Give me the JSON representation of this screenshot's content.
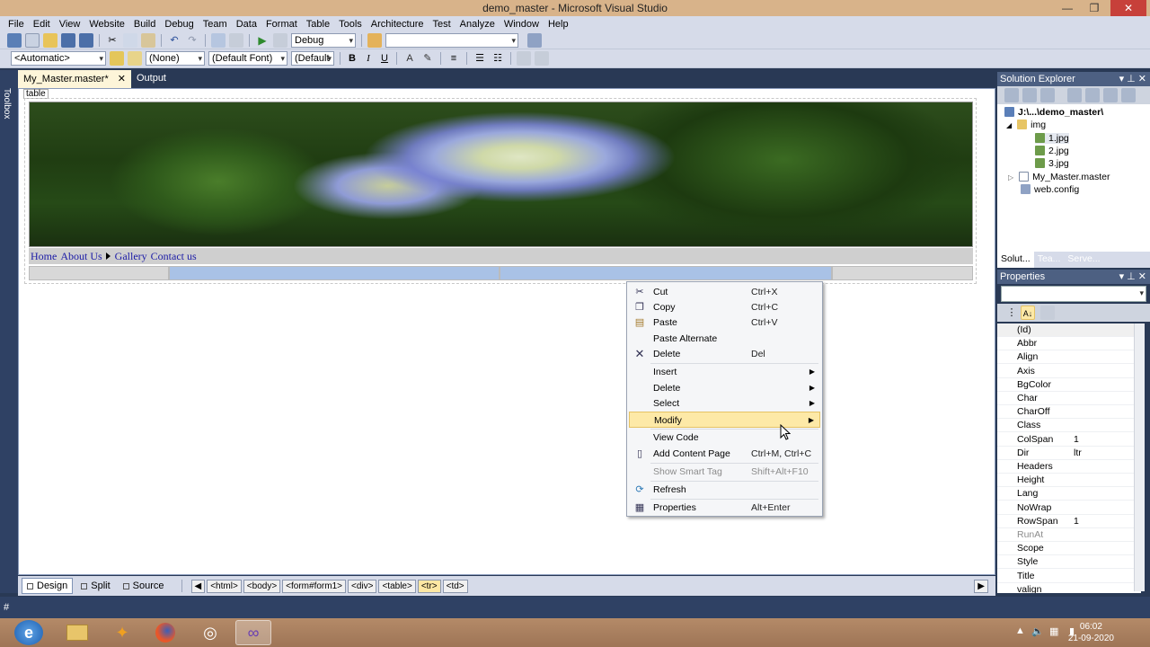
{
  "window": {
    "title": "demo_master - Microsoft Visual Studio",
    "controls": {
      "minimize": "—",
      "maximize": "❐",
      "close": "✕"
    }
  },
  "menu": [
    "File",
    "Edit",
    "View",
    "Website",
    "Build",
    "Debug",
    "Team",
    "Data",
    "Format",
    "Table",
    "Tools",
    "Architecture",
    "Test",
    "Analyze",
    "Window",
    "Help"
  ],
  "toolbar1": {
    "config": "Debug",
    "find": ""
  },
  "toolbar2": {
    "target": "<Automatic>",
    "style": "(None)",
    "font": "(Default Font)",
    "size": "(Default",
    "bold": "B",
    "italic": "I",
    "underline": "U"
  },
  "toolbox": {
    "label": "Toolbox"
  },
  "doc_tabs": [
    {
      "label": "My_Master.master*",
      "close": "✕"
    },
    {
      "label": "Output"
    }
  ],
  "design": {
    "tag_label": "table",
    "nav": [
      "Home",
      "About Us",
      "Gallery",
      "Contact us"
    ]
  },
  "context_menu": {
    "items": [
      {
        "label": "Cut",
        "shortcut": "Ctrl+X",
        "icon": "scissors-icon"
      },
      {
        "label": "Copy",
        "shortcut": "Ctrl+C",
        "icon": "copy-icon"
      },
      {
        "label": "Paste",
        "shortcut": "Ctrl+V",
        "icon": "paste-icon"
      },
      {
        "label": "Paste Alternate",
        "shortcut": ""
      },
      {
        "label": "Delete",
        "shortcut": "Del",
        "icon": "delete-x-icon"
      },
      {
        "label": "Insert",
        "shortcut": "",
        "submenu": true
      },
      {
        "label": "Delete",
        "shortcut": "",
        "submenu": true
      },
      {
        "label": "Select",
        "shortcut": "",
        "submenu": true
      },
      {
        "label": "Modify",
        "shortcut": "",
        "submenu": true,
        "highlighted": true
      },
      {
        "label": "View Code",
        "shortcut": ""
      },
      {
        "label": "Add Content Page",
        "shortcut": "Ctrl+M, Ctrl+C",
        "icon": "page-icon"
      },
      {
        "label": "Show Smart Tag",
        "shortcut": "Shift+Alt+F10",
        "disabled": true
      },
      {
        "label": "Refresh",
        "shortcut": "",
        "icon": "refresh-icon"
      },
      {
        "label": "Properties",
        "shortcut": "Alt+Enter",
        "icon": "properties-icon"
      }
    ]
  },
  "view_bar": {
    "design": "Design",
    "split": "Split",
    "source": "Source",
    "crumbs": [
      "<html>",
      "<body>",
      "<form#form1>",
      "<div>",
      "<table>",
      "<tr>",
      "<td>"
    ]
  },
  "solution_explorer": {
    "title": "Solution Explorer",
    "root": "J:\\...\\demo_master\\",
    "folder": "img",
    "files": [
      "1.jpg",
      "2.jpg",
      "3.jpg"
    ],
    "master": "My_Master.master",
    "config": "web.config",
    "tabs": [
      "Solut...",
      "Tea...",
      "Serve..."
    ]
  },
  "properties": {
    "title": "Properties",
    "rows": [
      {
        "name": "(Id)",
        "value": ""
      },
      {
        "name": "Abbr",
        "value": ""
      },
      {
        "name": "Align",
        "value": ""
      },
      {
        "name": "Axis",
        "value": ""
      },
      {
        "name": "BgColor",
        "value": ""
      },
      {
        "name": "Char",
        "value": ""
      },
      {
        "name": "CharOff",
        "value": ""
      },
      {
        "name": "Class",
        "value": ""
      },
      {
        "name": "ColSpan",
        "value": "1"
      },
      {
        "name": "Dir",
        "value": "ltr"
      },
      {
        "name": "Headers",
        "value": ""
      },
      {
        "name": "Height",
        "value": ""
      },
      {
        "name": "Lang",
        "value": ""
      },
      {
        "name": "NoWrap",
        "value": ""
      },
      {
        "name": "RowSpan",
        "value": "1"
      },
      {
        "name": "RunAt",
        "value": "",
        "disabled": true
      },
      {
        "name": "Scope",
        "value": ""
      },
      {
        "name": "Style",
        "value": ""
      },
      {
        "name": "Title",
        "value": ""
      },
      {
        "name": "valign",
        "value": ""
      }
    ]
  },
  "status": {
    "text": "#"
  },
  "taskbar": {
    "time": "06:02",
    "date": "21-09-2020"
  },
  "colors": {
    "titlebar": "#d8b38a",
    "chrome": "#d6dbe9",
    "frame": "#293955",
    "menu_highlight": "#fde9a7"
  }
}
